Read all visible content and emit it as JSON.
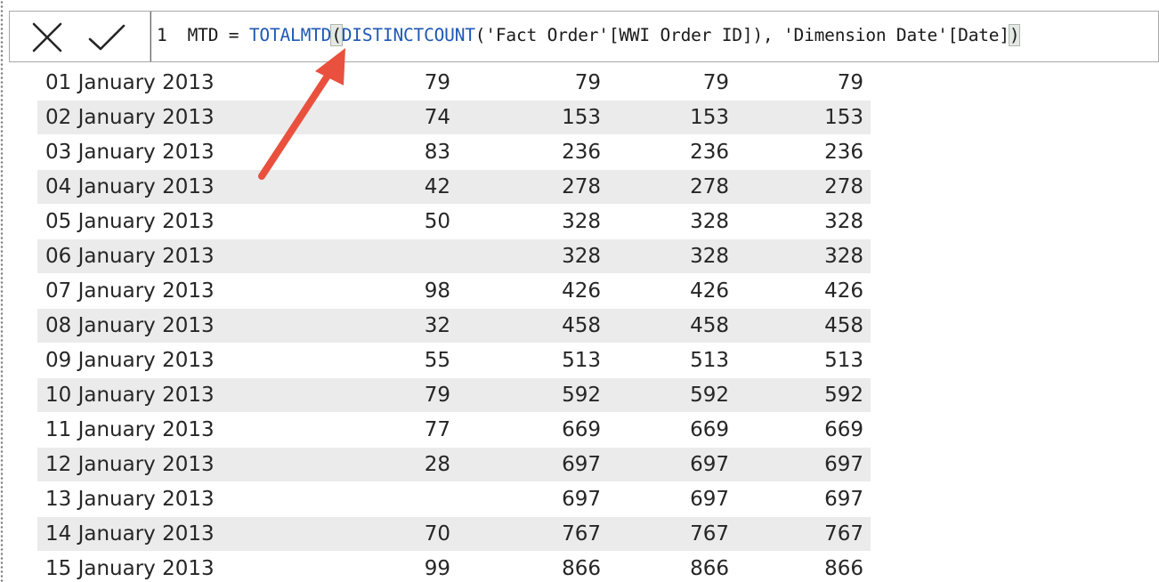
{
  "formula_bar": {
    "cancel_icon": "close-icon",
    "commit_icon": "checkmark-icon",
    "line_number": "1",
    "measure_name": "MTD",
    "equals": " = ",
    "fn_totalmtd": "TOTALMTD",
    "open_paren": "(",
    "fn_distinctcount": "DISTINCTCOUNT",
    "arg1": "('Fact Order'[WWI Order ID]), 'Dimension Date'[Date]",
    "close_paren": ")"
  },
  "colors": {
    "function_blue": "#1f58b5",
    "arrow_red": "#e9513e",
    "row_shade": "#ebebeb"
  },
  "table": {
    "rows": [
      {
        "date": "01 January 2013",
        "v1": "79",
        "v2": "79",
        "v3": "79",
        "v4": "79"
      },
      {
        "date": "02 January 2013",
        "v1": "74",
        "v2": "153",
        "v3": "153",
        "v4": "153"
      },
      {
        "date": "03 January 2013",
        "v1": "83",
        "v2": "236",
        "v3": "236",
        "v4": "236"
      },
      {
        "date": "04 January 2013",
        "v1": "42",
        "v2": "278",
        "v3": "278",
        "v4": "278"
      },
      {
        "date": "05 January 2013",
        "v1": "50",
        "v2": "328",
        "v3": "328",
        "v4": "328"
      },
      {
        "date": "06 January 2013",
        "v1": "",
        "v2": "328",
        "v3": "328",
        "v4": "328"
      },
      {
        "date": "07 January 2013",
        "v1": "98",
        "v2": "426",
        "v3": "426",
        "v4": "426"
      },
      {
        "date": "08 January 2013",
        "v1": "32",
        "v2": "458",
        "v3": "458",
        "v4": "458"
      },
      {
        "date": "09 January 2013",
        "v1": "55",
        "v2": "513",
        "v3": "513",
        "v4": "513"
      },
      {
        "date": "10 January 2013",
        "v1": "79",
        "v2": "592",
        "v3": "592",
        "v4": "592"
      },
      {
        "date": "11 January 2013",
        "v1": "77",
        "v2": "669",
        "v3": "669",
        "v4": "669"
      },
      {
        "date": "12 January 2013",
        "v1": "28",
        "v2": "697",
        "v3": "697",
        "v4": "697"
      },
      {
        "date": "13 January 2013",
        "v1": "",
        "v2": "697",
        "v3": "697",
        "v4": "697"
      },
      {
        "date": "14 January 2013",
        "v1": "70",
        "v2": "767",
        "v3": "767",
        "v4": "767"
      },
      {
        "date": "15 January 2013",
        "v1": "99",
        "v2": "866",
        "v3": "866",
        "v4": "866"
      }
    ]
  }
}
